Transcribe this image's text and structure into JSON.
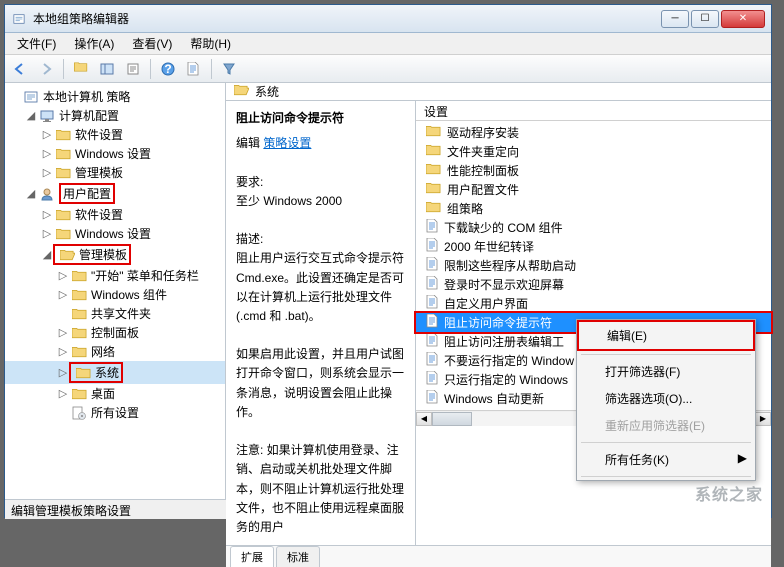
{
  "window": {
    "title": "本地组策略编辑器"
  },
  "menubar": [
    "文件(F)",
    "操作(A)",
    "查看(V)",
    "帮助(H)"
  ],
  "tree": {
    "root": "本地计算机 策略",
    "computer_config": "计算机配置",
    "cc_ss": "软件设置",
    "cc_ws": "Windows 设置",
    "cc_at": "管理模板",
    "user_config": "用户配置",
    "uc_ss": "软件设置",
    "uc_ws": "Windows 设置",
    "uc_at": "管理模板",
    "uc_start": "\"开始\" 菜单和任务栏",
    "uc_wincmp": "Windows 组件",
    "uc_share": "共享文件夹",
    "uc_cpanel": "控制面板",
    "uc_net": "网络",
    "uc_sys": "系统",
    "uc_desk": "桌面",
    "uc_all": "所有设置"
  },
  "rp": {
    "header": "系统",
    "detail_title": "阻止访问命令提示符",
    "edit_label": "编辑",
    "policy_link": "策略设置",
    "req_label": "要求:",
    "req_val": "至少 Windows 2000",
    "desc_label": "描述:",
    "desc_p1": "阻止用户运行交互式命令提示符 Cmd.exe。此设置还确定是否可以在计算机上运行批处理文件(.cmd 和 .bat)。",
    "desc_p2": "如果启用此设置，并且用户试图打开命令窗口，则系统会显示一条消息，说明设置会阻止此操作。",
    "desc_p3": "注意: 如果计算机使用登录、注销、启动或关机批处理文件脚本，则不阻止计算机运行批处理文件，也不阻止使用远程桌面服务的用户",
    "col_header": "设置",
    "tab_extended": "扩展",
    "tab_standard": "标准"
  },
  "policies": [
    "驱动程序安装",
    "文件夹重定向",
    "性能控制面板",
    "用户配置文件",
    "组策略",
    "下载缺少的 COM 组件",
    "2000 年世纪转译",
    "限制这些程序从帮助启动",
    "登录时不显示欢迎屏幕",
    "自定义用户界面",
    "阻止访问命令提示符",
    "阻止访问注册表编辑工",
    "不要运行指定的 Window",
    "只运行指定的 Windows",
    "Windows 自动更新"
  ],
  "policy_types": [
    "f",
    "f",
    "f",
    "f",
    "f",
    "d",
    "d",
    "d",
    "d",
    "d",
    "d",
    "d",
    "d",
    "d",
    "d"
  ],
  "policy_selected_index": 10,
  "context_menu": {
    "edit": "编辑(E)",
    "open_filter": "打开筛选器(F)",
    "filter_opts": "筛选器选项(O)...",
    "reapply": "重新应用筛选器(E)",
    "all_tasks": "所有任务(K)"
  },
  "statusbar": "编辑管理模板策略设置",
  "watermark": "系统之家"
}
